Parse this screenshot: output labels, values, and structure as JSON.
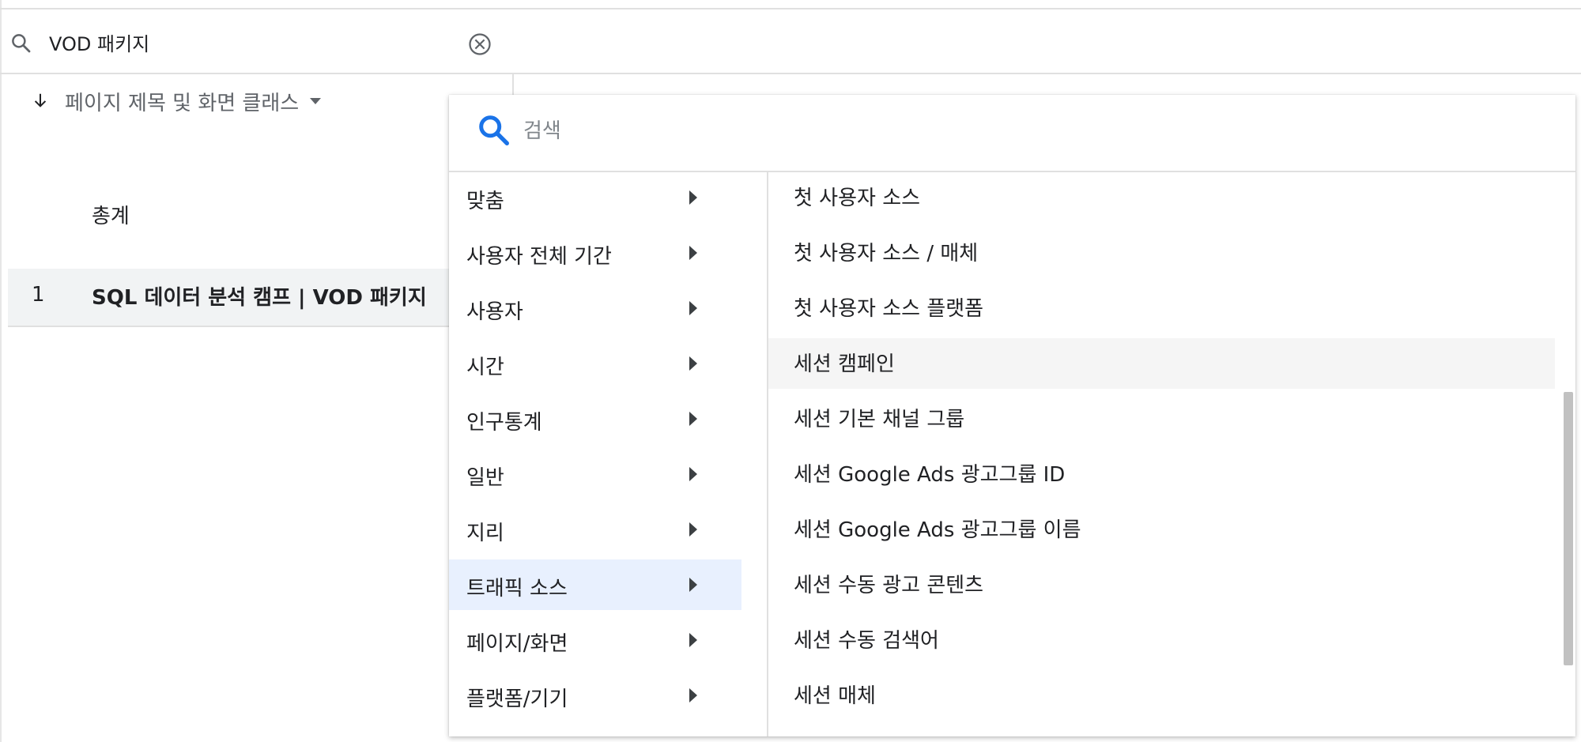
{
  "search": {
    "value": "VOD 패키지"
  },
  "sort": {
    "label": "페이지 제목 및 화면 클래스"
  },
  "table": {
    "totals_label": "총계",
    "rows": [
      {
        "index": "1",
        "text": "SQL 데이터 분석 캠프 | VOD 패키지"
      }
    ]
  },
  "dropdown": {
    "search_placeholder": "검색",
    "categories": [
      {
        "label": "맞춤"
      },
      {
        "label": "사용자 전체 기간"
      },
      {
        "label": "사용자"
      },
      {
        "label": "시간"
      },
      {
        "label": "인구통계"
      },
      {
        "label": "일반"
      },
      {
        "label": "지리"
      },
      {
        "label": "트래픽 소스"
      },
      {
        "label": "페이지/화면"
      },
      {
        "label": "플랫폼/기기"
      }
    ],
    "selected_category": "트래픽 소스",
    "items": [
      {
        "label": "첫 사용자 소스"
      },
      {
        "label": "첫 사용자 소스 / 매체"
      },
      {
        "label": "첫 사용자 소스 플랫폼"
      },
      {
        "label": "세션 캠페인"
      },
      {
        "label": "세션 기본 채널 그룹"
      },
      {
        "label": "세션 Google Ads 광고그룹 ID"
      },
      {
        "label": "세션 Google Ads 광고그룹 이름"
      },
      {
        "label": "세션 수동 광고 콘텐츠"
      },
      {
        "label": "세션 수동 검색어"
      },
      {
        "label": "세션 매체"
      }
    ],
    "hovered_item": "세션 캠페인"
  },
  "colors": {
    "accent": "#1a73e8",
    "selected_bg": "#e8f0fe",
    "hover_bg": "#f5f5f5"
  }
}
